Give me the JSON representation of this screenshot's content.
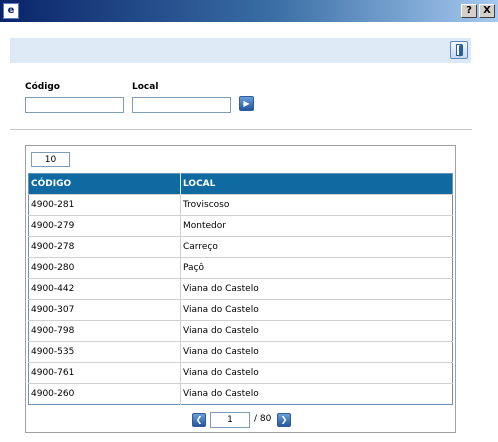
{
  "window": {
    "help_label": "?",
    "close_label": "X",
    "icon": "app-icon"
  },
  "toolbar": {
    "exit_icon": "exit-door-icon"
  },
  "filters": {
    "codigo_label": "Código",
    "codigo_value": "",
    "local_label": "Local",
    "local_value": "",
    "go_icon": "arrow-right-icon"
  },
  "results": {
    "page_size": "10",
    "columns": [
      "CÓDIGO",
      "LOCAL"
    ],
    "rows": [
      {
        "codigo": "4900-281",
        "local": "Troviscoso"
      },
      {
        "codigo": "4900-279",
        "local": "Montedor"
      },
      {
        "codigo": "4900-278",
        "local": "Carreço"
      },
      {
        "codigo": "4900-280",
        "local": "Paçô"
      },
      {
        "codigo": "4900-442",
        "local": "Viana do Castelo"
      },
      {
        "codigo": "4900-307",
        "local": "Viana do Castelo"
      },
      {
        "codigo": "4900-798",
        "local": "Viana do Castelo"
      },
      {
        "codigo": "4900-535",
        "local": "Viana do Castelo"
      },
      {
        "codigo": "4900-761",
        "local": "Viana do Castelo"
      },
      {
        "codigo": "4900-260",
        "local": "Viana do Castelo"
      }
    ]
  },
  "pager": {
    "current_page": "1",
    "total_label": "/ 80",
    "prev_icon": "chevron-left-icon",
    "next_icon": "chevron-right-icon"
  },
  "colors": {
    "header_bg": "#0e6aa0",
    "strip_bg": "#dde9f5",
    "titlebar_start": "#0a246a"
  }
}
